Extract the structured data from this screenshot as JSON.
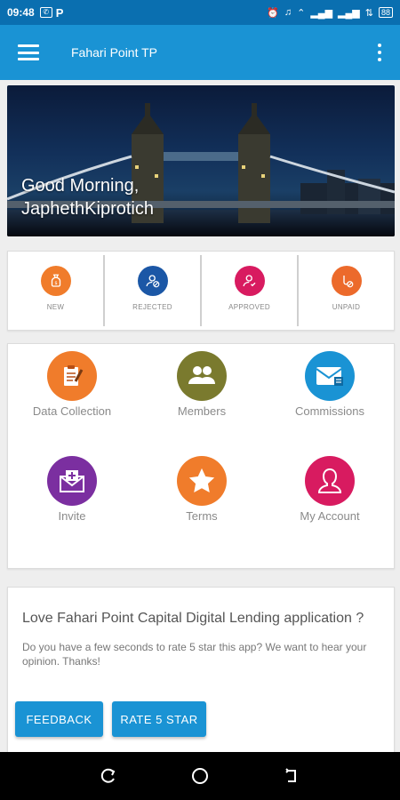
{
  "status_bar": {
    "time": "09:48",
    "notif_icons": [
      "whatsapp-icon",
      "p-icon"
    ],
    "system_icons": [
      "alarm-icon",
      "headset-icon",
      "wifi-icon",
      "signal-icon",
      "signal-icon",
      "data-icon"
    ],
    "battery": "88"
  },
  "app_bar": {
    "title": "Fahari Point TP",
    "menu_icon": "hamburger-icon",
    "overflow_icon": "more-vert-icon"
  },
  "hero": {
    "greeting_line1": "Good Morning,",
    "greeting_line2": "JaphethKiprotich"
  },
  "statuses": [
    {
      "label": "NEW",
      "color": "#f07c2b",
      "icon": "money-bag-icon"
    },
    {
      "label": "REJECTED",
      "color": "#1b57a6",
      "icon": "user-block-icon"
    },
    {
      "label": "APPROVED",
      "color": "#d81b60",
      "icon": "user-check-icon"
    },
    {
      "label": "UNPAID",
      "color": "#ec6a2b",
      "icon": "unpaid-icon"
    }
  ],
  "tiles": [
    {
      "label": "Data Collection",
      "color": "#f07c2b",
      "icon": "clipboard-icon"
    },
    {
      "label": "Members",
      "color": "#7a7a2e",
      "icon": "group-icon"
    },
    {
      "label": "Commissions",
      "color": "#1a93d4",
      "icon": "mail-icon"
    },
    {
      "label": "Invite",
      "color": "#7b2fa0",
      "icon": "invite-mail-icon"
    },
    {
      "label": "Terms",
      "color": "#f07c2b",
      "icon": "star-icon"
    },
    {
      "label": "My Account",
      "color": "#d81b60",
      "icon": "person-icon"
    }
  ],
  "rate": {
    "title": "Love Fahari Point Capital Digital Lending application ?",
    "text": "Do you have a few seconds to rate 5 star this app? We want to hear your opinion. Thanks!",
    "feedback_label": "FEEDBACK",
    "rate_label": "RATE 5 STAR"
  },
  "colors": {
    "status_bar": "#0a6fb0",
    "app_bar": "#1a93d4",
    "accent": "#1a93d4"
  }
}
